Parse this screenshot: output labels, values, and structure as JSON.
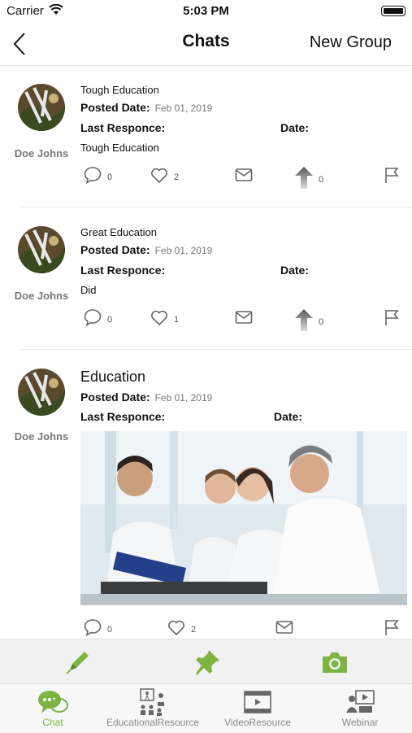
{
  "status": {
    "carrier": "Carrier",
    "time": "5:03 PM"
  },
  "nav": {
    "title": "Chats",
    "new_group": "New Group"
  },
  "labels": {
    "posted_date": "Posted Date:",
    "last_response": "Last Responce:",
    "date": "Date:"
  },
  "posts": [
    {
      "author": "Doe Johns",
      "title": "Tough Education",
      "posted_date": "Feb 01, 2019",
      "body": "Tough Education",
      "comments": "0",
      "likes": "2",
      "upvotes": "0"
    },
    {
      "author": "Doe Johns",
      "title": "Great Education",
      "posted_date": "Feb 01, 2019",
      "body": "Did",
      "comments": "0",
      "likes": "1",
      "upvotes": "0"
    },
    {
      "author": "Doe Johns",
      "title": "Education",
      "posted_date": "Feb 01, 2019",
      "body": "",
      "comments": "0",
      "likes": "2",
      "upvotes": ""
    }
  ],
  "tabs": [
    {
      "label": "Chat",
      "icon": "chat-bubbles-icon",
      "active": true
    },
    {
      "label": "EducationalResource",
      "icon": "classroom-icon",
      "active": false
    },
    {
      "label": "VideoResource",
      "icon": "film-icon",
      "active": false
    },
    {
      "label": "Webinar",
      "icon": "webinar-icon",
      "active": false
    }
  ],
  "colors": {
    "accent": "#7cb341",
    "icon_gray": "#666666"
  }
}
